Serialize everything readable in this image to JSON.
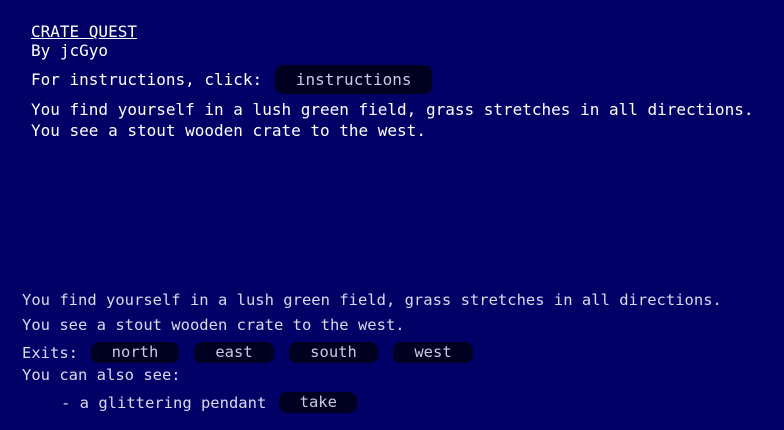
{
  "header": {
    "title": "CRATE QUEST",
    "byline": "By jcGyo",
    "instructions_prompt": "For instructions, click:",
    "instructions_button": "instructions"
  },
  "intro": {
    "line1": "You find yourself in a lush green field, grass stretches in all directions.",
    "line2": "You see a stout wooden crate to the west."
  },
  "room": {
    "line1": "You find yourself in a lush green field, grass stretches in all directions.",
    "line2": "You see a stout wooden crate to the west.",
    "exits_label": "Exits:",
    "exits": [
      "north",
      "east",
      "south",
      "west"
    ],
    "also_see_label": "You can also see:",
    "item": "- a glittering pendant",
    "take_label": "take"
  },
  "colors": {
    "background": "#000066",
    "button_bg": "#000020",
    "text": "#ffffff"
  }
}
